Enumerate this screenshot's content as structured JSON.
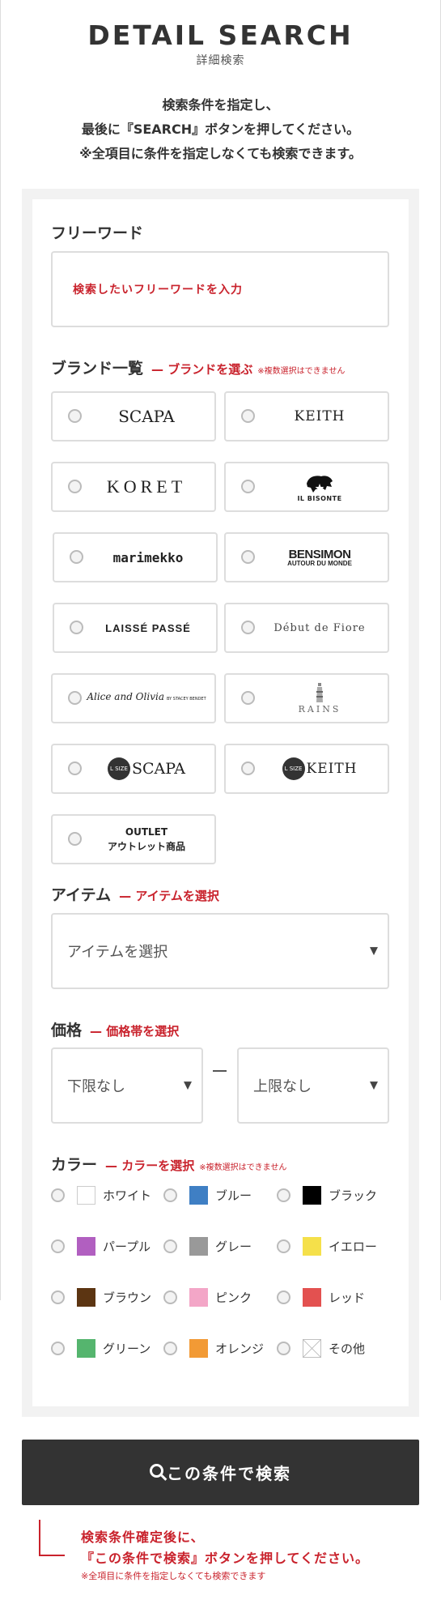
{
  "header": {
    "title": "DETAIL SEARCH",
    "subtitle": "詳細検索",
    "intro": [
      "検索条件を指定し、",
      "最後に『SEARCH』ボタンを押してください。",
      "※全項目に条件を指定しなくても検索できます。"
    ]
  },
  "freeword": {
    "label": "フリーワード",
    "placeholder": "検索したいフリーワードを入力"
  },
  "brand": {
    "label": "ブランド一覧",
    "sub": "— ブランドを選ぶ",
    "note": "※複数選択はできません",
    "items": [
      {
        "name": "SCAPA",
        "icon": "scapa-logo"
      },
      {
        "name": "KEITH",
        "icon": "keith-logo"
      },
      {
        "name": "KORET",
        "icon": "koret-logo"
      },
      {
        "name": "IL BISONTE",
        "icon": "il-bisonte-logo"
      },
      {
        "name": "marimekko",
        "icon": "marimekko-logo"
      },
      {
        "name": "BENSIMON",
        "name2": "AUTOUR DU MONDE",
        "icon": "bensimon-logo"
      },
      {
        "name": "LAISSÉ PASSÉ",
        "icon": "laisse-passe-logo"
      },
      {
        "name": "Début de Fiore",
        "icon": "debut-de-fiore-logo"
      },
      {
        "name": "Alice and Olivia",
        "name2": "BY STACEY BENDET",
        "icon": "alice-olivia-logo"
      },
      {
        "name": "RAINS",
        "icon": "rains-logo"
      },
      {
        "name": "SCAPA",
        "badge": "L SIZE",
        "icon": "scapa-lsize-logo"
      },
      {
        "name": "KEITH",
        "badge": "L SIZE",
        "icon": "keith-lsize-logo"
      },
      {
        "name": "OUTLET",
        "name2": "アウトレット商品",
        "icon": "outlet-label"
      }
    ]
  },
  "item": {
    "label": "アイテム",
    "sub": "— アイテムを選択",
    "select_value": "アイテムを選択"
  },
  "price": {
    "label": "価格",
    "sub": "— 価格帯を選択",
    "min_value": "下限なし",
    "max_value": "上限なし"
  },
  "color": {
    "label": "カラー",
    "sub": "— カラーを選択",
    "note": "※複数選択はできません",
    "items": [
      {
        "name": "ホワイト",
        "hex": "#ffffff"
      },
      {
        "name": "ブルー",
        "hex": "#3f7fc4"
      },
      {
        "name": "ブラック",
        "hex": "#000000"
      },
      {
        "name": "パープル",
        "hex": "#b15fc0"
      },
      {
        "name": "グレー",
        "hex": "#999999"
      },
      {
        "name": "イエロー",
        "hex": "#f5e04a"
      },
      {
        "name": "ブラウン",
        "hex": "#5c3512"
      },
      {
        "name": "ピンク",
        "hex": "#f3a6c7"
      },
      {
        "name": "レッド",
        "hex": "#e35150"
      },
      {
        "name": "グリーン",
        "hex": "#55b56e"
      },
      {
        "name": "オレンジ",
        "hex": "#f29a35"
      },
      {
        "name": "その他",
        "hex": "none"
      }
    ]
  },
  "search_button": {
    "label": "この条件で検索"
  },
  "footer_note": {
    "line1": "検索条件確定後に、",
    "line2": "『この条件で検索』ボタンを押してください。",
    "line3": "※全項目に条件を指定しなくても検索できます"
  },
  "colors": {
    "accent_red": "#c9222c",
    "button_dark": "#333333",
    "panel_bg": "#f2f2f2"
  }
}
